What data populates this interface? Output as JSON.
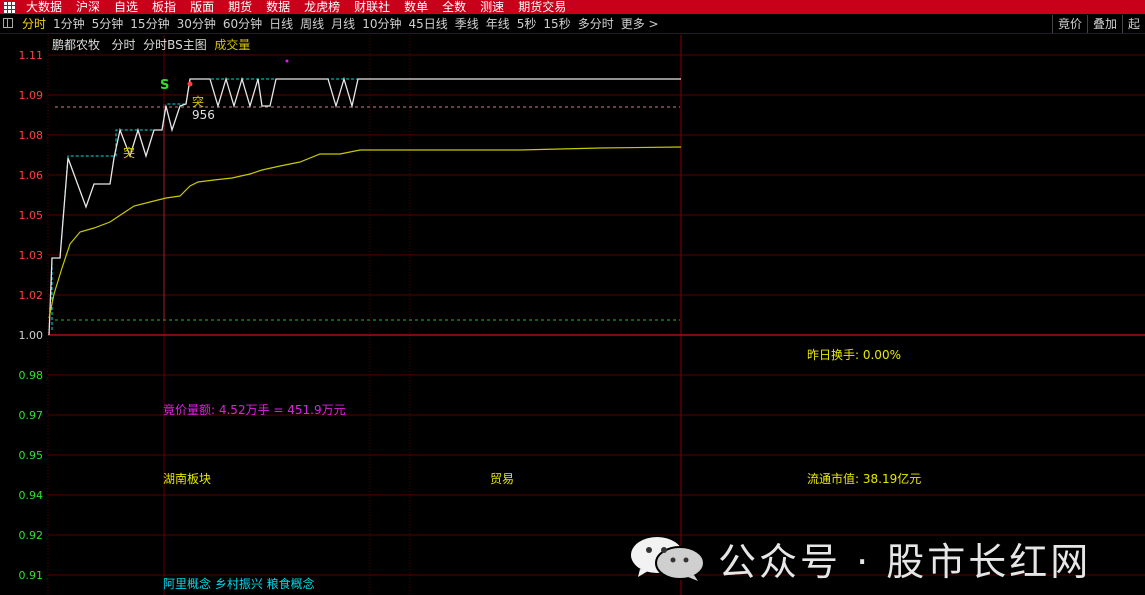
{
  "menu": {
    "items": [
      "大数据",
      "沪深",
      "自选",
      "板指",
      "版面",
      "期货",
      "数据",
      "龙虎榜",
      "财联社",
      "数单",
      "全数",
      "测速",
      "期货交易"
    ]
  },
  "tabs": {
    "items": [
      "分时",
      "1分钟",
      "5分钟",
      "15分钟",
      "30分钟",
      "60分钟",
      "日线",
      "周线",
      "月线",
      "10分钟",
      "45日线",
      "季线",
      "年线",
      "5秒",
      "15秒",
      "多分时",
      "更多 >"
    ],
    "active": 0,
    "right": [
      "竟价",
      "叠加",
      "起"
    ]
  },
  "chart": {
    "stock_name": "鹏都农牧",
    "mode": "分时",
    "indicator": "分时BS主图",
    "volume_label": "成交量",
    "signal_s": "S",
    "signal_break": "突",
    "signal_break2": "突",
    "signal_value": "956",
    "y_ticks": [
      "1.11",
      "1.09",
      "1.08",
      "1.06",
      "1.05",
      "1.03",
      "1.02",
      "1.00",
      "0.98",
      "0.97",
      "0.95",
      "0.94",
      "0.92",
      "0.91"
    ],
    "colors": {
      "up": "#ff4040",
      "down": "#2ee02e",
      "base": "#d0d0d0",
      "price": "#e8e8e8",
      "avg": "#c8c800",
      "cyan": "#00e0e0",
      "magenta": "#e020e0",
      "grid": "#5a0000"
    }
  },
  "info": {
    "auction_volume": "竟价量额: 4.52万手 = 451.9万元",
    "prev_turnover": "昨日换手: 0.00%",
    "sector": "湖南板块",
    "industry": "贸易",
    "float_cap": "流通市值: 38.19亿元",
    "concepts": "阿里概念 乡村振兴 粮食概念"
  },
  "watermark": {
    "text": "公众号 · 股市长红网"
  }
}
